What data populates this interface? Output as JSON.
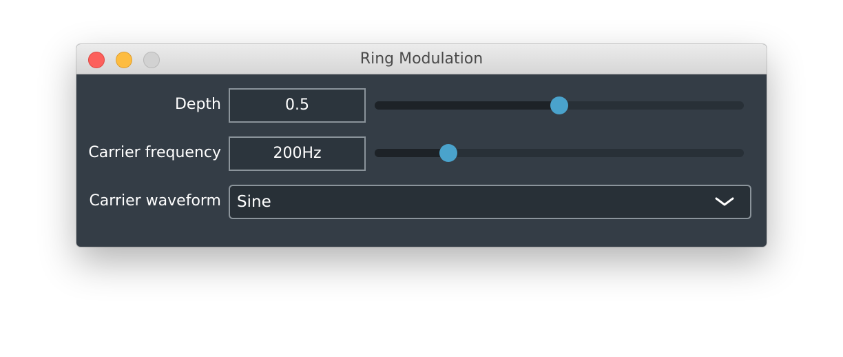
{
  "window": {
    "title": "Ring Modulation"
  },
  "controls": {
    "depth": {
      "label": "Depth",
      "value": "0.5",
      "slider_fraction": 0.5
    },
    "carrier_frequency": {
      "label": "Carrier frequency",
      "value": "200Hz",
      "slider_fraction": 0.2
    },
    "carrier_waveform": {
      "label": "Carrier waveform",
      "selected": "Sine",
      "icon": "chevron-down-icon"
    }
  },
  "colors": {
    "panel_bg": "#343d46",
    "accent": "#4aa3cc",
    "close": "#fc605c",
    "minimize": "#fdbc40",
    "maximize": "#d2d2d2"
  }
}
